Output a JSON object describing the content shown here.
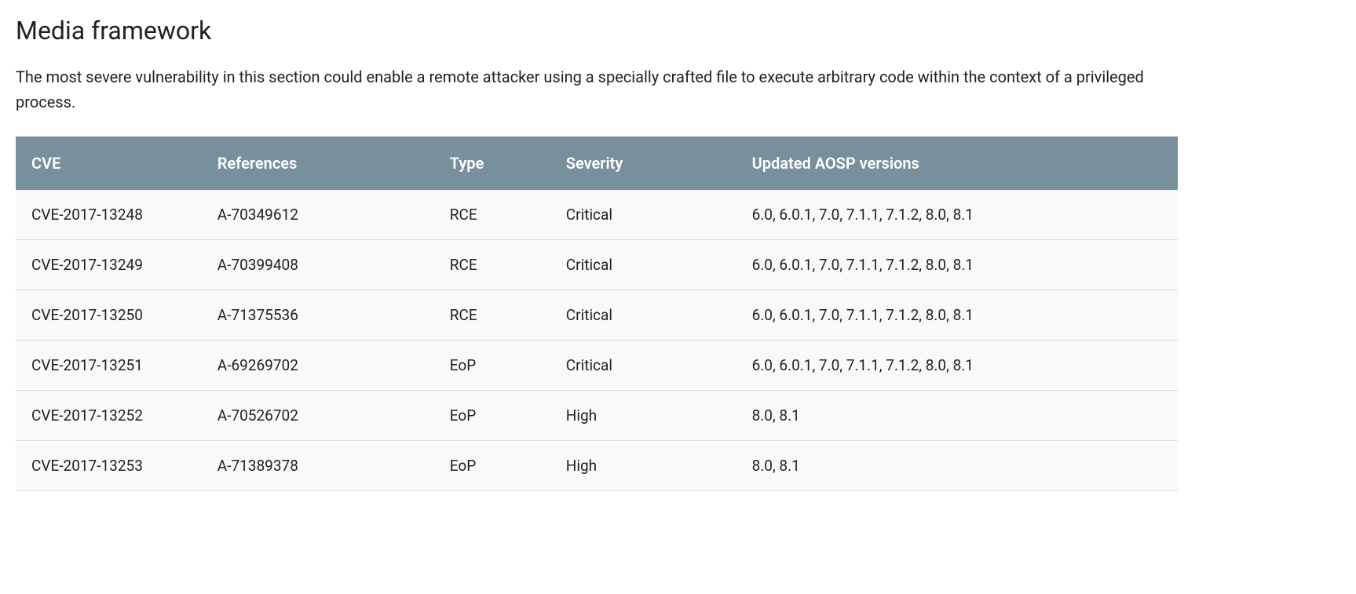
{
  "section": {
    "title": "Media framework",
    "description": "The most severe vulnerability in this section could enable a remote attacker using a specially crafted file to execute arbitrary code within the context of a privileged process."
  },
  "table": {
    "headers": {
      "cve": "CVE",
      "references": "References",
      "type": "Type",
      "severity": "Severity",
      "versions": "Updated AOSP versions"
    },
    "rows": [
      {
        "cve": "CVE-2017-13248",
        "references": "A-70349612",
        "type": "RCE",
        "severity": "Critical",
        "versions": "6.0, 6.0.1, 7.0, 7.1.1, 7.1.2, 8.0, 8.1"
      },
      {
        "cve": "CVE-2017-13249",
        "references": "A-70399408",
        "type": "RCE",
        "severity": "Critical",
        "versions": "6.0, 6.0.1, 7.0, 7.1.1, 7.1.2, 8.0, 8.1"
      },
      {
        "cve": "CVE-2017-13250",
        "references": "A-71375536",
        "type": "RCE",
        "severity": "Critical",
        "versions": "6.0, 6.0.1, 7.0, 7.1.1, 7.1.2, 8.0, 8.1"
      },
      {
        "cve": "CVE-2017-13251",
        "references": "A-69269702",
        "type": "EoP",
        "severity": "Critical",
        "versions": "6.0, 6.0.1, 7.0, 7.1.1, 7.1.2, 8.0, 8.1"
      },
      {
        "cve": "CVE-2017-13252",
        "references": "A-70526702",
        "type": "EoP",
        "severity": "High",
        "versions": "8.0, 8.1"
      },
      {
        "cve": "CVE-2017-13253",
        "references": "A-71389378",
        "type": "EoP",
        "severity": "High",
        "versions": "8.0, 8.1"
      }
    ]
  }
}
